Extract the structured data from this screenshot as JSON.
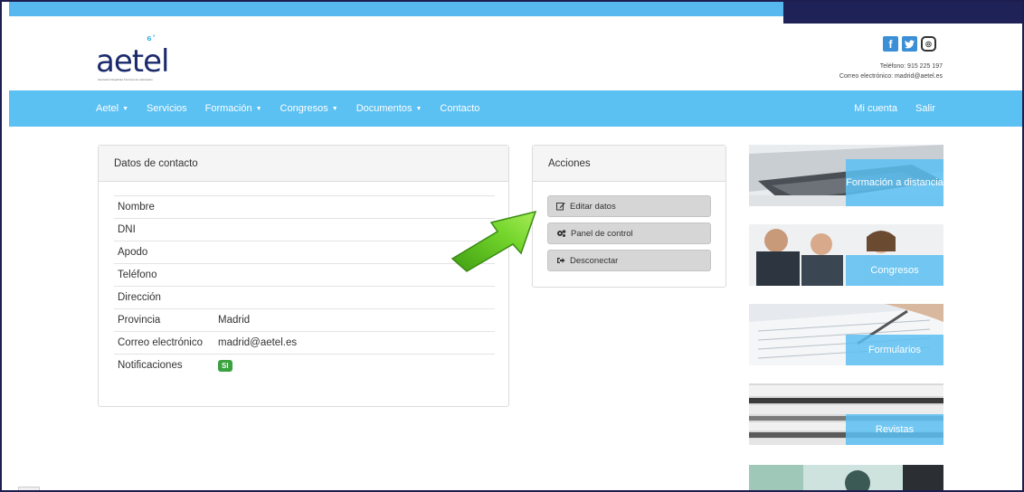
{
  "brand": {
    "logo_text": "aetel",
    "logo_mark": "⁶ʾ",
    "tagline": "Asociación Española Técnicos de Laboratorio"
  },
  "social": {
    "facebook": "f",
    "twitter": "t",
    "instagram": "◎"
  },
  "header_contact": {
    "phone": "Teléfono: 915 225 197",
    "email": "Correo electrónico: madrid@aetel.es"
  },
  "nav": {
    "items": [
      {
        "label": "Aetel",
        "dropdown": true
      },
      {
        "label": "Servicios",
        "dropdown": false
      },
      {
        "label": "Formación",
        "dropdown": true
      },
      {
        "label": "Congresos",
        "dropdown": true
      },
      {
        "label": "Documentos",
        "dropdown": true
      },
      {
        "label": "Contacto",
        "dropdown": false
      }
    ],
    "caret": "▼",
    "account": "Mi cuenta",
    "logout": "Salir"
  },
  "contact_panel": {
    "title": "Datos de contacto",
    "rows": [
      {
        "label": "Nombre",
        "value": ""
      },
      {
        "label": "DNI",
        "value": ""
      },
      {
        "label": "Apodo",
        "value": ""
      },
      {
        "label": "Teléfono",
        "value": ""
      },
      {
        "label": "Dirección",
        "value": ""
      },
      {
        "label": "Provincia",
        "value": "Madrid"
      },
      {
        "label": "Correo electrónico",
        "value": "madrid@aetel.es"
      },
      {
        "label": "Notificaciones",
        "value": "SI"
      }
    ]
  },
  "actions_panel": {
    "title": "Acciones",
    "edit": "Editar datos",
    "control": "Panel de control",
    "disconnect": "Desconectar"
  },
  "tiles": {
    "formacion": "Formación a distancia",
    "congresos": "Congresos",
    "formularios": "Formularios",
    "revistas": "Revistas"
  },
  "colors": {
    "nav": "#5bc0f2",
    "topbar": "#57b8f0",
    "topbar_dark": "#1f2256",
    "badge": "#3aa23e",
    "arrow": "#5cc21c"
  }
}
